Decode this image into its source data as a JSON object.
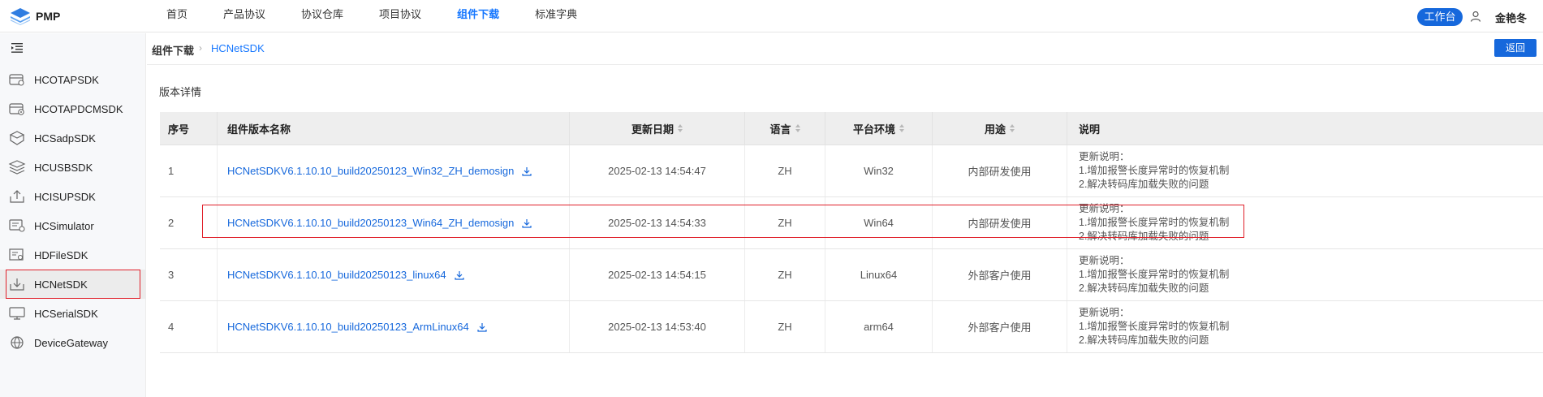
{
  "header": {
    "logo_text": "PMP",
    "nav": [
      {
        "label": "首页",
        "active": false
      },
      {
        "label": "产品协议",
        "active": false
      },
      {
        "label": "协议仓库",
        "active": false
      },
      {
        "label": "项目协议",
        "active": false
      },
      {
        "label": "组件下载",
        "active": true
      },
      {
        "label": "标准字典",
        "active": false
      }
    ],
    "workbench_label": "工作台",
    "user_name": "金艳冬"
  },
  "sidebar": {
    "items": [
      {
        "label": "HCOTAPSDK",
        "icon": "package-icon"
      },
      {
        "label": "HCOTAPDCMSDK",
        "icon": "package-settings-icon"
      },
      {
        "label": "HCSadpSDK",
        "icon": "cube-icon"
      },
      {
        "label": "HCUSBSDK",
        "icon": "layers-icon"
      },
      {
        "label": "HCISUPSDK",
        "icon": "upload-box-icon"
      },
      {
        "label": "HCSimulator",
        "icon": "simulator-icon"
      },
      {
        "label": "HDFileSDK",
        "icon": "file-search-icon"
      },
      {
        "label": "HCNetSDK",
        "icon": "download-box-icon",
        "selected": true
      },
      {
        "label": "HCSerialSDK",
        "icon": "monitor-icon"
      },
      {
        "label": "DeviceGateway",
        "icon": "gateway-icon"
      }
    ]
  },
  "breadcrumb": {
    "parent": "组件下载",
    "current": "HCNetSDK"
  },
  "back_label": "返回",
  "section_title": "版本详情",
  "table": {
    "headers": {
      "index": "序号",
      "name": "组件版本名称",
      "date": "更新日期",
      "lang": "语言",
      "platform": "平台环境",
      "usage": "用途",
      "desc": "说明"
    },
    "rows": [
      {
        "index": "1",
        "name": "HCNetSDKV6.1.10.10_build20250123_Win32_ZH_demosign",
        "date": "2025-02-13 14:54:47",
        "lang": "ZH",
        "platform": "Win32",
        "usage": "内部研发使用",
        "desc": [
          "更新说明：",
          "1.增加报警长度异常时的恢复机制",
          "2.解决转码库加载失败的问题"
        ]
      },
      {
        "index": "2",
        "name": "HCNetSDKV6.1.10.10_build20250123_Win64_ZH_demosign",
        "date": "2025-02-13 14:54:33",
        "lang": "ZH",
        "platform": "Win64",
        "usage": "内部研发使用",
        "desc": [
          "更新说明：",
          "1.增加报警长度异常时的恢复机制",
          "2.解决转码库加载失败的问题"
        ]
      },
      {
        "index": "3",
        "name": "HCNetSDKV6.1.10.10_build20250123_linux64",
        "date": "2025-02-13 14:54:15",
        "lang": "ZH",
        "platform": "Linux64",
        "usage": "外部客户使用",
        "desc": [
          "更新说明：",
          "1.增加报警长度异常时的恢复机制",
          "2.解决转码库加载失败的问题"
        ]
      },
      {
        "index": "4",
        "name": "HCNetSDKV6.1.10.10_build20250123_ArmLinux64",
        "date": "2025-02-13 14:53:40",
        "lang": "ZH",
        "platform": "arm64",
        "usage": "外部客户使用",
        "desc": [
          "更新说明：",
          "1.增加报警长度异常时的恢复机制",
          "2.解决转码库加载失败的问题"
        ]
      }
    ]
  },
  "colors": {
    "accent": "#1668dc",
    "highlight": "#e0202a"
  }
}
